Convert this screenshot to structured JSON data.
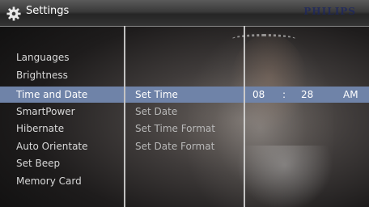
{
  "header": {
    "title": "Settings",
    "brand": "PHILIPS",
    "icon": "gear-icon"
  },
  "menu": {
    "items": [
      {
        "label": "Languages"
      },
      {
        "label": "Brightness"
      },
      {
        "label": "Time and Date"
      },
      {
        "label": "SmartPower"
      },
      {
        "label": "Hibernate"
      },
      {
        "label": "Auto Orientate"
      },
      {
        "label": "Set Beep"
      },
      {
        "label": "Memory Card"
      }
    ],
    "selected_index": 2
  },
  "submenu": {
    "items": [
      {
        "label": "Set Time"
      },
      {
        "label": "Set Date"
      },
      {
        "label": "Set Time Format"
      },
      {
        "label": "Set Date Format"
      }
    ],
    "selected_index": 0
  },
  "time": {
    "hour": "08",
    "separator": ":",
    "minute": "28",
    "ampm": "AM"
  },
  "colors": {
    "highlight": "#6f83a8",
    "text": "#d8d8d8"
  }
}
